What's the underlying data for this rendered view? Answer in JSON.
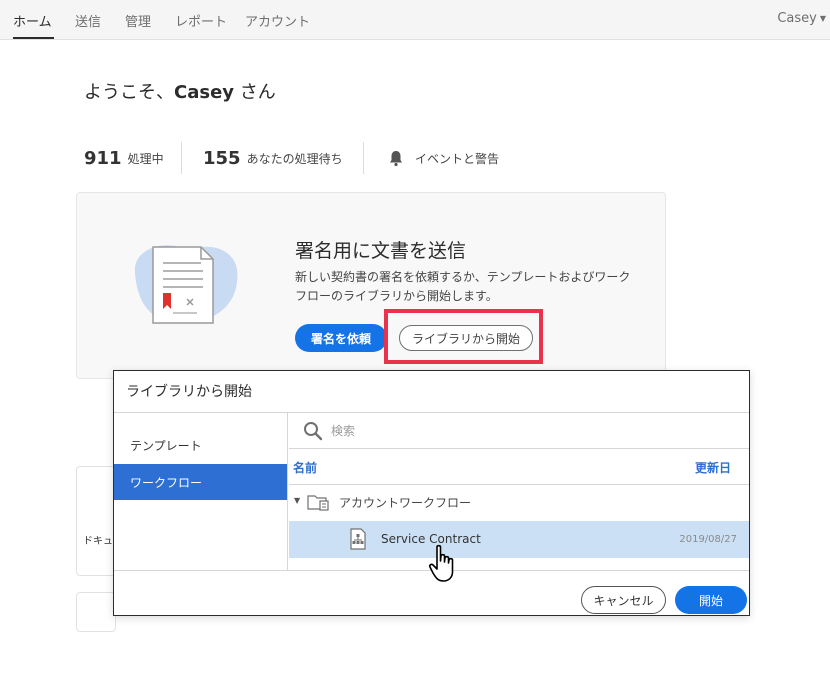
{
  "nav": {
    "items": [
      "ホーム",
      "送信",
      "管理",
      "レポート",
      "アカウント"
    ],
    "user": "Casey"
  },
  "welcome": {
    "prefix": "ようこそ、",
    "name": "Casey",
    "suffix": " さん"
  },
  "stats": {
    "in_progress_count": "911",
    "in_progress_label": "処理中",
    "waiting_count": "155",
    "waiting_label": "あなたの処理待ち",
    "events_label": "イベントと警告"
  },
  "send_card": {
    "title": "署名用に文書を送信",
    "description": "新しい契約書の署名を依頼するか、テンプレートおよびワークフローのライブラリから開始します。",
    "request_button": "署名を依頼",
    "library_button": "ライブラリから開始"
  },
  "background": {
    "frag_doc": "ドキュ"
  },
  "dialog": {
    "title": "ライブラリから開始",
    "side_items": [
      "テンプレート",
      "ワークフロー"
    ],
    "search_placeholder": "検索",
    "col_name": "名前",
    "col_updated": "更新日",
    "folder": "アカウントワークフロー",
    "item_name": "Service Contract",
    "item_date": "2019/08/27",
    "cancel": "キャンセル",
    "start": "開始"
  },
  "colors": {
    "accent": "#1473e6",
    "selected_nav": "#2d6fd2",
    "selected_row": "#cce0f5",
    "highlight": "#e8334a"
  }
}
